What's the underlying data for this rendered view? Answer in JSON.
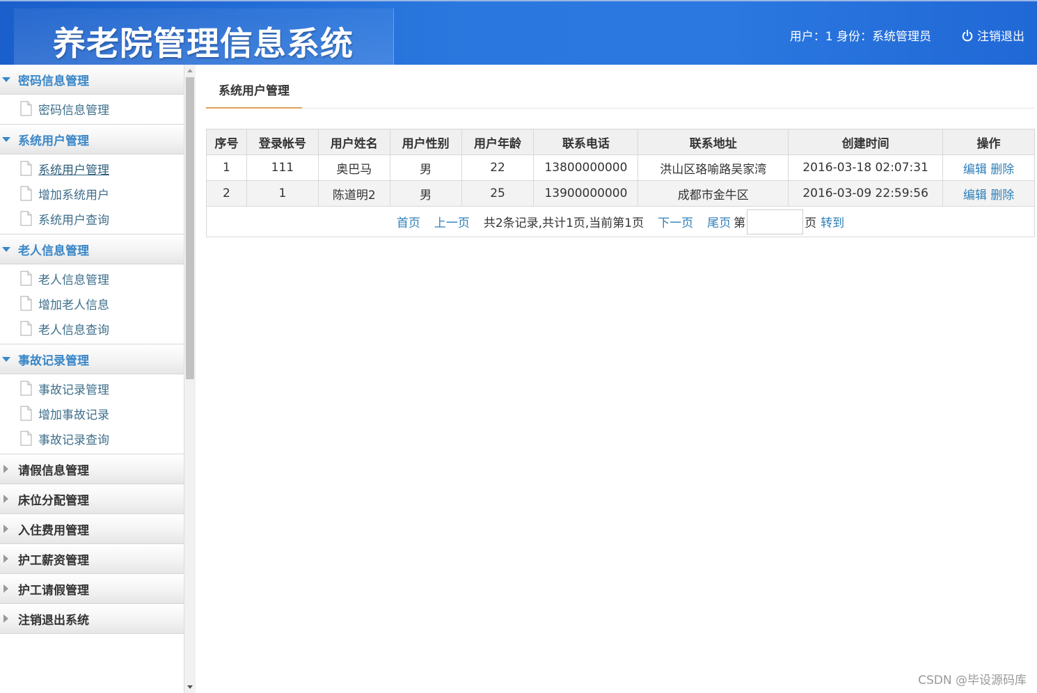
{
  "header": {
    "title": "养老院管理信息系统",
    "user_info": "用户：1 身份：系统管理员",
    "logout_label": "注销退出"
  },
  "sidebar": {
    "groups": [
      {
        "label": "密码信息管理",
        "open": true,
        "items": [
          {
            "label": "密码信息管理"
          }
        ]
      },
      {
        "label": "系统用户管理",
        "open": true,
        "items": [
          {
            "label": "系统用户管理",
            "active": true
          },
          {
            "label": "增加系统用户"
          },
          {
            "label": "系统用户查询"
          }
        ]
      },
      {
        "label": "老人信息管理",
        "open": true,
        "items": [
          {
            "label": "老人信息管理"
          },
          {
            "label": "增加老人信息"
          },
          {
            "label": "老人信息查询"
          }
        ]
      },
      {
        "label": "事故记录管理",
        "open": true,
        "items": [
          {
            "label": "事故记录管理"
          },
          {
            "label": "增加事故记录"
          },
          {
            "label": "事故记录查询"
          }
        ]
      },
      {
        "label": "请假信息管理",
        "open": false
      },
      {
        "label": "床位分配管理",
        "open": false
      },
      {
        "label": "入住费用管理",
        "open": false
      },
      {
        "label": "护工薪资管理",
        "open": false
      },
      {
        "label": "护工请假管理",
        "open": false
      },
      {
        "label": "注销退出系统",
        "open": false
      }
    ]
  },
  "main": {
    "tab_label": "系统用户管理",
    "table": {
      "columns": [
        "序号",
        "登录帐号",
        "用户姓名",
        "用户性别",
        "用户年龄",
        "联系电话",
        "联系地址",
        "创建时间",
        "操作"
      ],
      "rows": [
        [
          "1",
          "111",
          "奥巴马",
          "男",
          "22",
          "13800000000",
          "洪山区珞喻路吴家湾",
          "2016-03-18 02:07:31"
        ],
        [
          "2",
          "1",
          "陈道明2",
          "男",
          "25",
          "13900000000",
          "成都市金牛区",
          "2016-03-09 22:59:56"
        ]
      ],
      "edit_label": "编辑",
      "delete_label": "删除"
    },
    "pager": {
      "first": "首页",
      "prev": "上一页",
      "summary": "共2条记录,共计1页,当前第1页",
      "next": "下一页",
      "last": "尾页",
      "page_prefix": "第",
      "page_suffix": "页",
      "goto": "转到",
      "page_input_value": ""
    }
  },
  "watermark": "CSDN @毕设源码库",
  "colors": {
    "header_blue": "#2a78df",
    "link_blue": "#2f7fb8",
    "group_open": "#3a87c8",
    "tab_underline": "#e0a058"
  }
}
